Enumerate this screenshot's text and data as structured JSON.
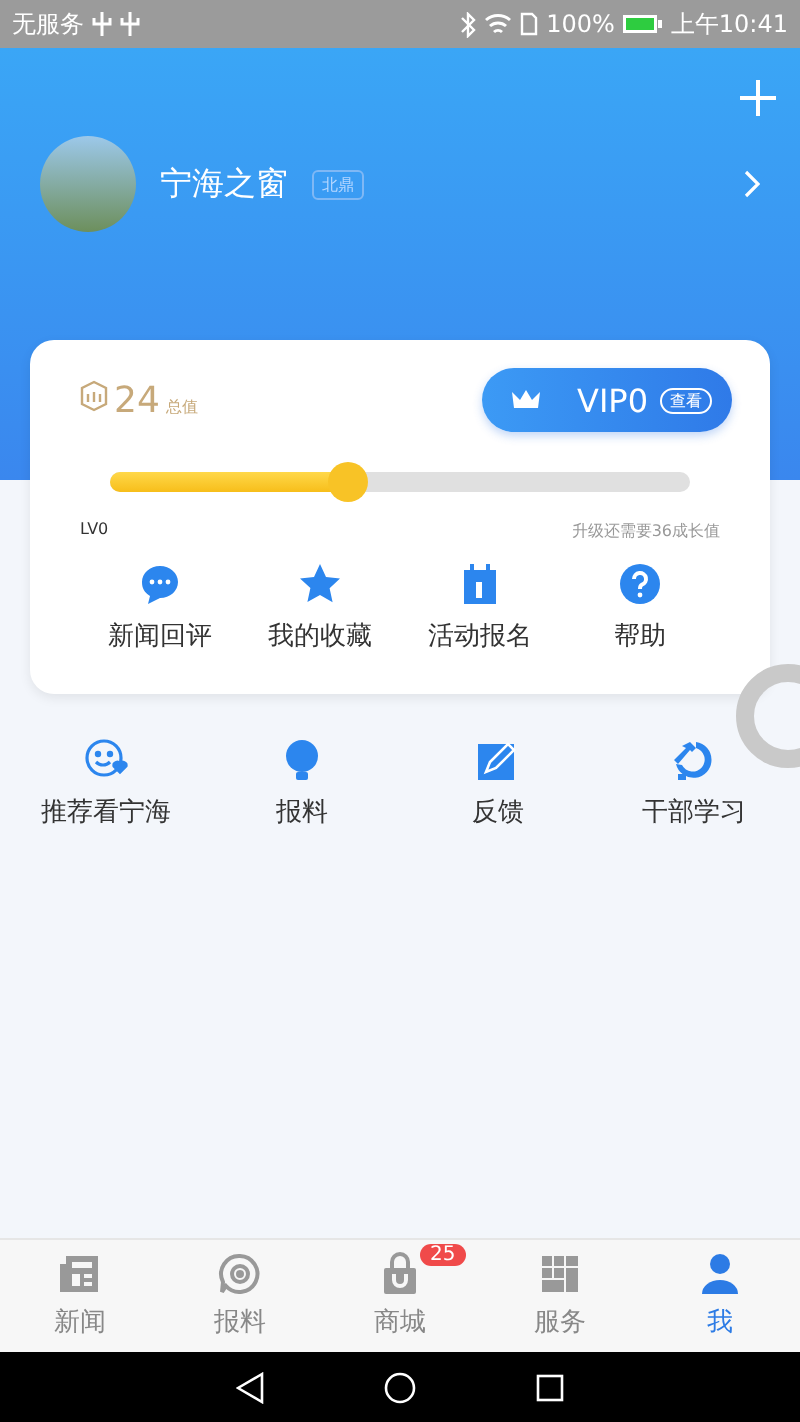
{
  "status_bar": {
    "carrier": "无服务",
    "battery": "100%",
    "time": "上午10:41"
  },
  "profile": {
    "name": "宁海之窗",
    "tag": "北鼎"
  },
  "points": {
    "value": "24",
    "unit": "总值"
  },
  "vip": {
    "label": "VIP0",
    "action": "查看"
  },
  "growth": {
    "level": 0.41,
    "current_level": "LV0",
    "hint": "升级还需要36成长值"
  },
  "card_actions": [
    {
      "kind": "comment",
      "label": "新闻回评"
    },
    {
      "kind": "star",
      "label": "我的收藏"
    },
    {
      "kind": "calendar",
      "label": "活动报名"
    },
    {
      "kind": "help",
      "label": "帮助"
    }
  ],
  "services": [
    {
      "kind": "smile",
      "label": "推荐看宁海"
    },
    {
      "kind": "bulb",
      "label": "报料"
    },
    {
      "kind": "edit",
      "label": "反馈"
    },
    {
      "kind": "emblem",
      "label": "干部学习"
    }
  ],
  "tabs": [
    {
      "kind": "news",
      "label": "新闻",
      "selected": false
    },
    {
      "kind": "report",
      "label": "报料",
      "selected": false
    },
    {
      "kind": "shop",
      "label": "商城",
      "selected": false,
      "badge": "25"
    },
    {
      "kind": "grid",
      "label": "服务",
      "selected": false
    },
    {
      "kind": "user",
      "label": "我",
      "selected": true
    }
  ]
}
